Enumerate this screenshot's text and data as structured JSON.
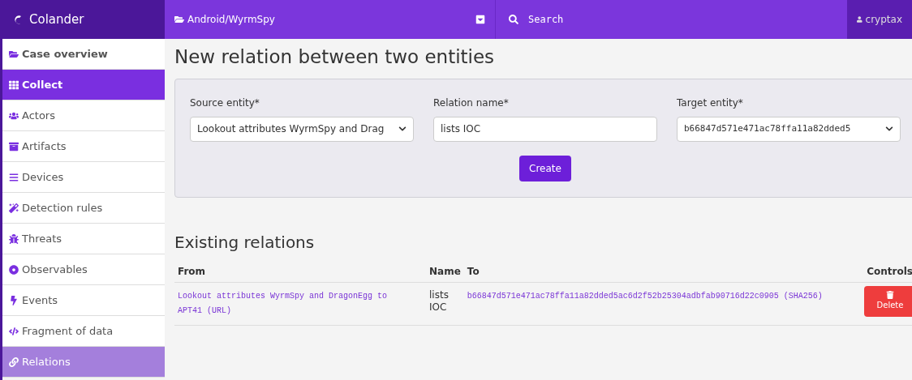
{
  "brand": "Colander",
  "topbar": {
    "case": "Android/WyrmSpy",
    "search_placeholder": "Search",
    "user": "cryptax"
  },
  "sidebar": {
    "items": [
      {
        "label": "Case overview",
        "kind": "section",
        "selected": false
      },
      {
        "label": "Collect",
        "kind": "section",
        "selected": true
      },
      {
        "label": "Actors",
        "kind": "link",
        "selected": false
      },
      {
        "label": "Artifacts",
        "kind": "link",
        "selected": false
      },
      {
        "label": "Devices",
        "kind": "link",
        "selected": false
      },
      {
        "label": "Detection rules",
        "kind": "link",
        "selected": false
      },
      {
        "label": "Threats",
        "kind": "link",
        "selected": false
      },
      {
        "label": "Observables",
        "kind": "link",
        "selected": false
      },
      {
        "label": "Events",
        "kind": "link",
        "selected": false
      },
      {
        "label": "Fragment of data",
        "kind": "link",
        "selected": false
      },
      {
        "label": "Relations",
        "kind": "link",
        "selected": true
      }
    ]
  },
  "form": {
    "title": "New relation between two entities",
    "source": {
      "label": "Source entity*",
      "value": "Lookout attributes WyrmSpy and Drag"
    },
    "relation": {
      "label": "Relation name*",
      "value": "lists IOC"
    },
    "target": {
      "label": "Target entity*",
      "value": "b66847d571e471ac78ffa11a82dded5"
    },
    "submit": "Create"
  },
  "existing": {
    "title": "Existing relations",
    "columns": [
      "From",
      "Name",
      "To",
      "Controls"
    ],
    "rows": [
      {
        "from": "Lookout attributes WyrmSpy and DragonEgg to APT41 (URL)",
        "name": "lists IOC",
        "to": "b66847d571e471ac78ffa11a82dded5ac6d2f52b25304adbfab90716d22c0905 (SHA256)",
        "action": "Delete"
      }
    ]
  }
}
